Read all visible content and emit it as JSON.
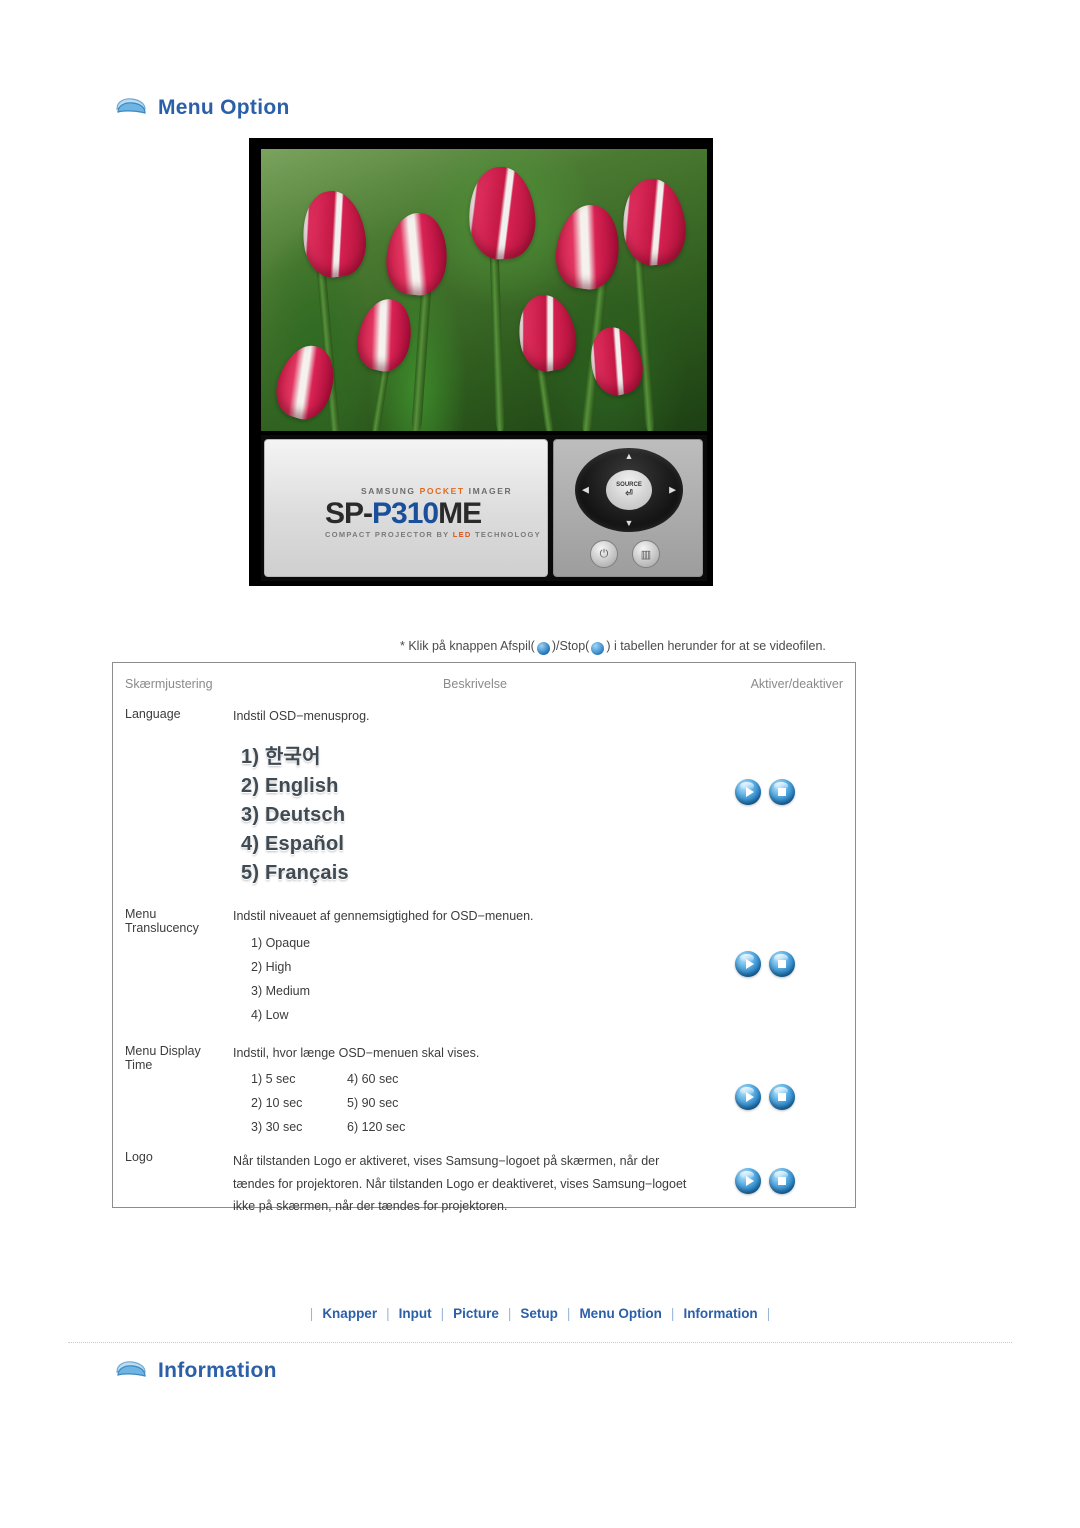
{
  "page": {
    "section_heading": "Menu Option",
    "footer_heading": "Information"
  },
  "product": {
    "brand_line_1": "SAMSUNG",
    "brand_line_pocket": "POCKET",
    "brand_line_2": "IMAGER",
    "model_prefix": "SP-",
    "model_main": "P310",
    "model_suffix": "ME",
    "tagline_1": "COMPACT PROJECTOR BY",
    "tagline_led": "LED",
    "tagline_2": "TECHNOLOGY",
    "source_label": "SOURCE"
  },
  "note": {
    "prefix": "* Klik på knappen Afspil(",
    "middle": ")/Stop(",
    "suffix": ") i tabellen herunder for at se videofilen."
  },
  "table": {
    "headers": [
      "Skærmjustering",
      "Beskrivelse",
      "Aktiver/deaktiver"
    ],
    "rows": [
      {
        "name": "Language",
        "description": "Indstil OSD−menusprog.",
        "options": [
          "1) 한국어",
          "2) English",
          "3) Deutsch",
          "4) Español",
          "5) Français"
        ],
        "option_style": "language",
        "actions": [
          "play",
          "stop"
        ]
      },
      {
        "name": "Menu Translucency",
        "description": "Indstil niveauet af gennemsigtighed for OSD−menuen.",
        "options": [
          "1) Opaque",
          "2) High",
          "3) Medium",
          "4) Low"
        ],
        "option_style": "list",
        "actions": [
          "play",
          "stop"
        ]
      },
      {
        "name": "Menu Display Time",
        "description": "Indstil, hvor længe OSD−menuen skal vises.",
        "options_left": [
          "1) 5 sec",
          "2) 10 sec",
          "3) 30 sec"
        ],
        "options_right": [
          "4) 60 sec",
          "5) 90 sec",
          "6) 120 sec"
        ],
        "option_style": "grid",
        "actions": [
          "play",
          "stop"
        ]
      },
      {
        "name": "Logo",
        "description": "Når tilstanden Logo er aktiveret, vises Samsung−logoet på skærmen, når der tændes for projektoren. Når tilstanden Logo er deaktiveret, vises Samsung−logoet ikke på skærmen, når der tændes for projektoren.",
        "option_style": "none",
        "actions": [
          "play",
          "stop"
        ]
      }
    ]
  },
  "bottom_nav": {
    "items": [
      "Knapper",
      "Input",
      "Picture",
      "Setup",
      "Menu Option",
      "Information"
    ],
    "separator": "|"
  }
}
